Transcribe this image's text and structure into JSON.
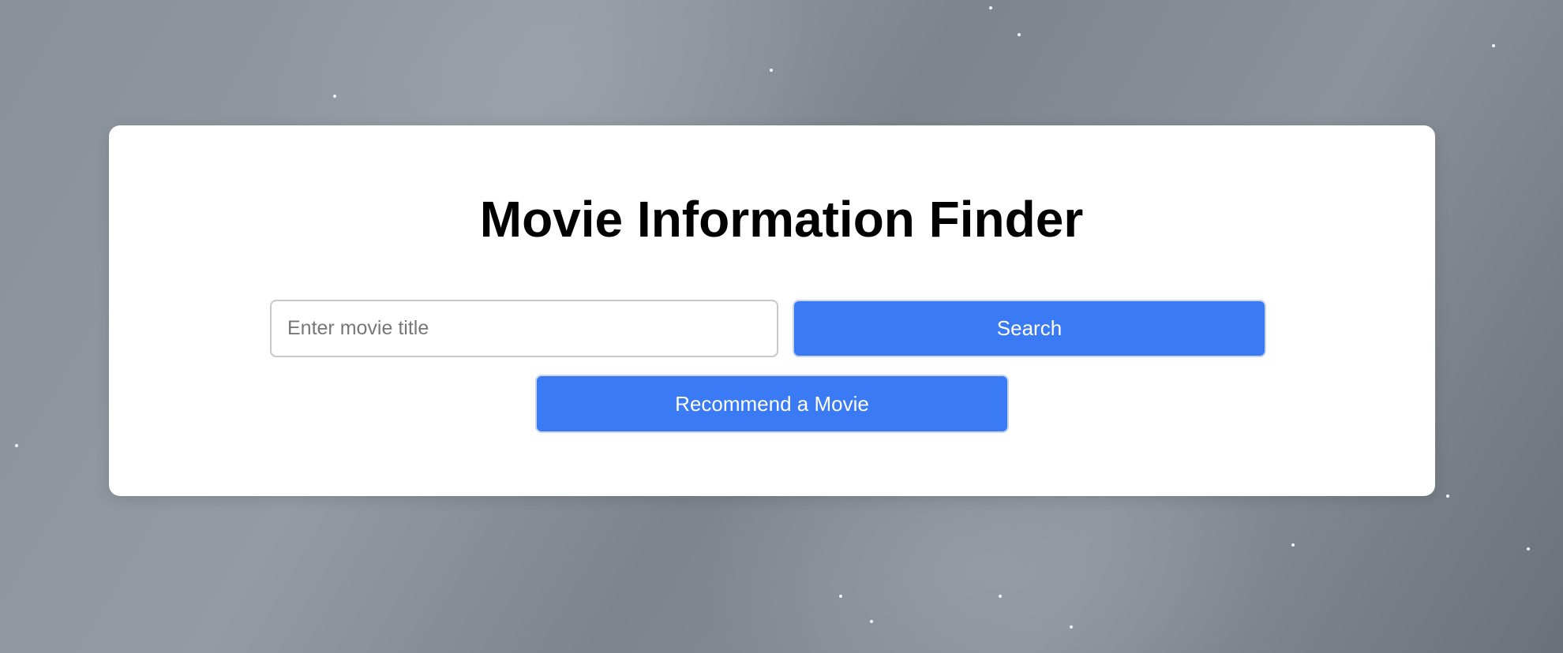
{
  "app": {
    "title": "Movie Information Finder"
  },
  "search": {
    "placeholder": "Enter movie title",
    "value": "",
    "button_label": "Search"
  },
  "recommend": {
    "button_label": "Recommend a Movie"
  },
  "colors": {
    "accent": "#3a7af5",
    "card_background": "#ffffff",
    "page_background": "#8a9099"
  }
}
